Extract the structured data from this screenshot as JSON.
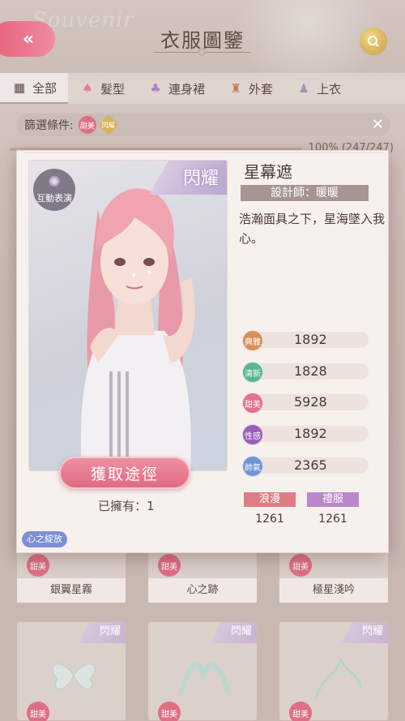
{
  "header": {
    "title": "衣服圖鑒",
    "bg_script": "Souvenir"
  },
  "tabs": [
    {
      "label": "全部",
      "icon": "grid-icon"
    },
    {
      "label": "髮型",
      "icon": "hair-icon"
    },
    {
      "label": "連身裙",
      "icon": "dress-icon"
    },
    {
      "label": "外套",
      "icon": "coat-icon"
    },
    {
      "label": "上衣",
      "icon": "top-icon"
    }
  ],
  "filter": {
    "label": "篩選條件:",
    "tags": [
      "甜美",
      "閃耀"
    ]
  },
  "collection_progress": "100% (247/247)",
  "grid_items": [
    {
      "name": "銀翼星霧",
      "tag": "甜美"
    },
    {
      "name": "心之跡",
      "tag": "甜美"
    },
    {
      "name": "極星淺吟",
      "tag": "甜美"
    },
    {
      "name": "",
      "tag": "甜美",
      "ribbon": "閃耀"
    },
    {
      "name": "",
      "tag": "甜美",
      "ribbon": "閃耀"
    },
    {
      "name": "",
      "tag": "甜美",
      "ribbon": "閃耀"
    }
  ],
  "detail": {
    "ribbon": "閃耀",
    "interact_label": "互動表演",
    "name": "星幕遮",
    "designer": "設計師：暖暖",
    "description": "浩瀚面具之下，星海墜入我心。",
    "obtain_button": "獲取途徑",
    "owned": "已擁有：1",
    "theme_tag": "心之綻放",
    "stats": [
      {
        "label": "典雅",
        "value": "1892",
        "color": "#d9905a"
      },
      {
        "label": "清新",
        "value": "1828",
        "color": "#5bb58e"
      },
      {
        "label": "甜美",
        "value": "5928",
        "color": "#e2718a"
      },
      {
        "label": "性感",
        "value": "1892",
        "color": "#9a5fb6"
      },
      {
        "label": "帥氣",
        "value": "2365",
        "color": "#6f96d6"
      }
    ],
    "attributes": [
      {
        "label": "浪漫",
        "value": "1261",
        "color": "#e07c84"
      },
      {
        "label": "禮服",
        "value": "1261",
        "color": "#b888c8"
      }
    ]
  }
}
